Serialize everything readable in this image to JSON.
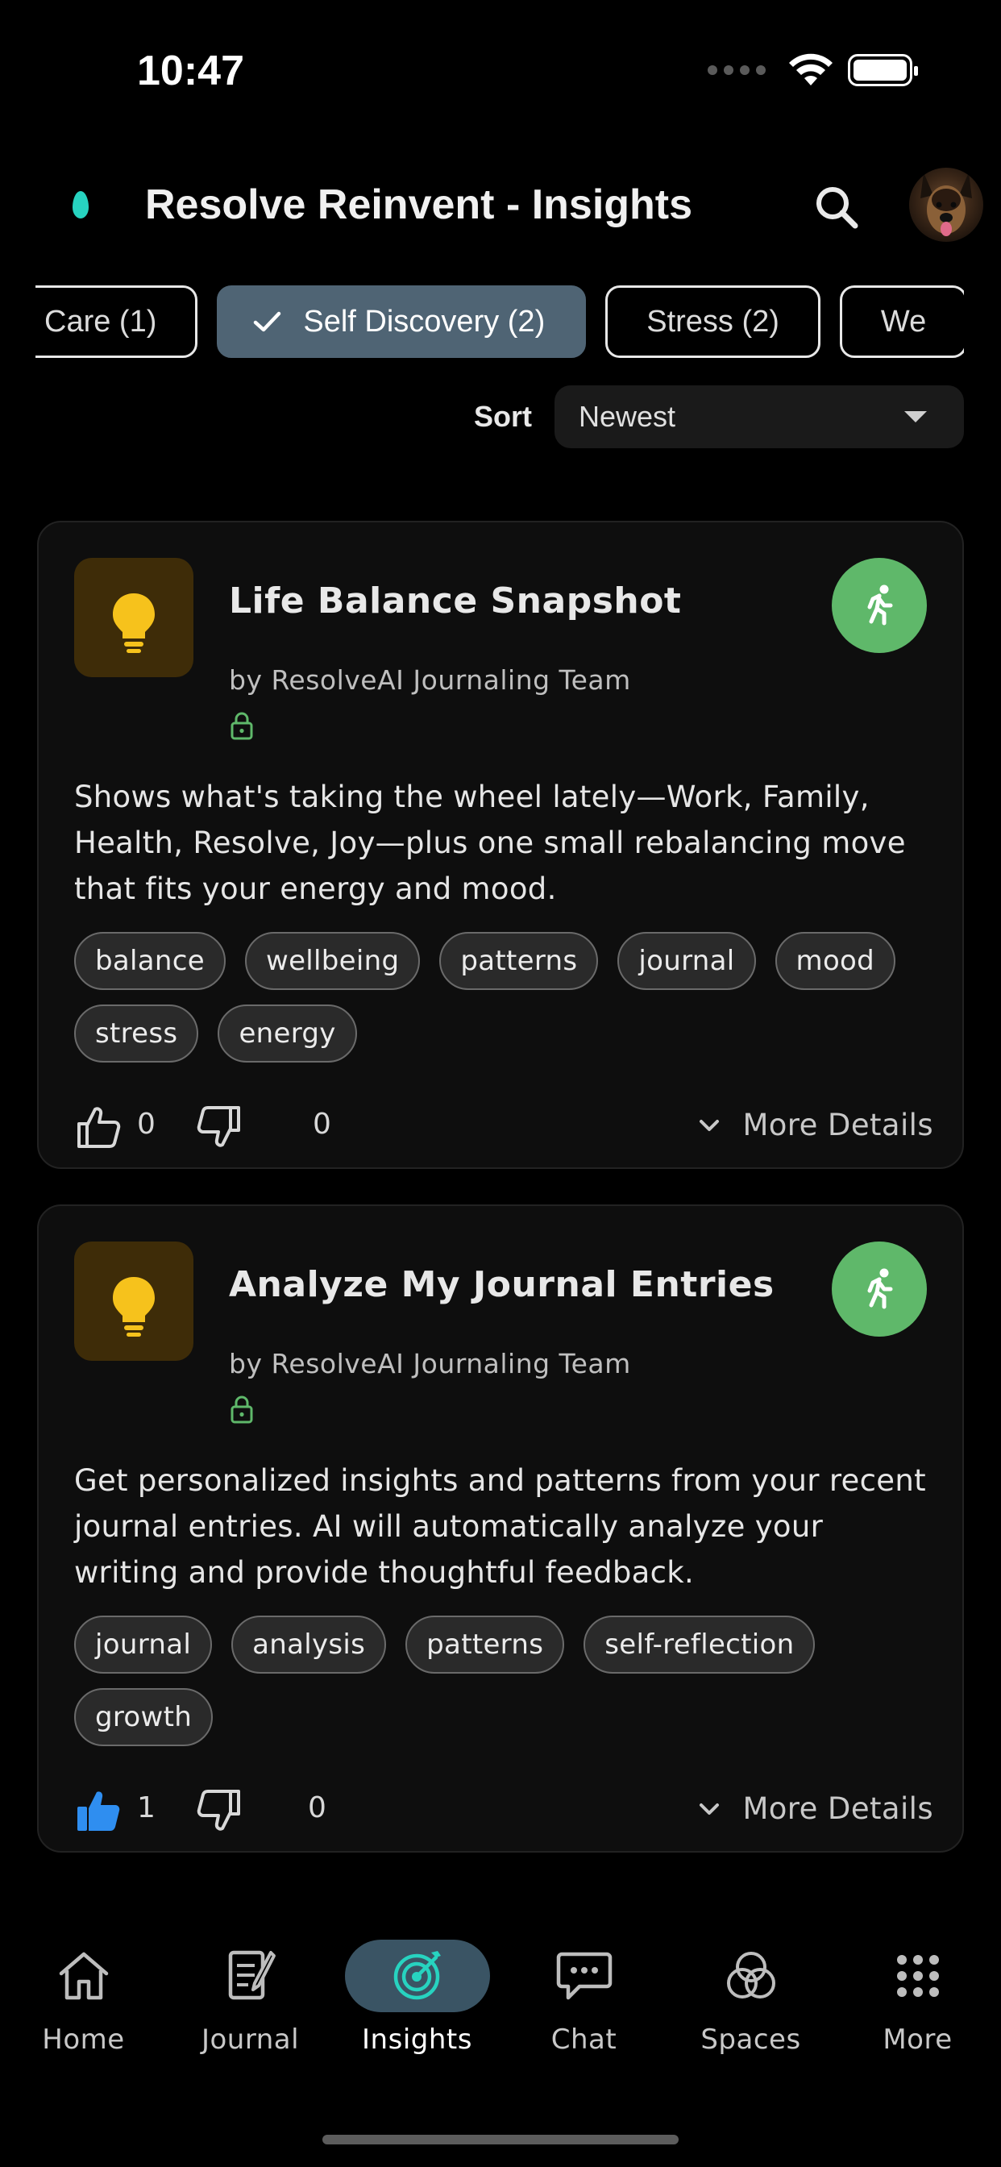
{
  "status_bar": {
    "time": "10:47"
  },
  "header": {
    "title": "Resolve Reinvent - Insights",
    "search_icon": "search-icon",
    "avatar_icon": "dog-avatar"
  },
  "filters": {
    "chips": [
      {
        "label": "Care (1)",
        "selected": false
      },
      {
        "label": "Self Discovery (2)",
        "selected": true
      },
      {
        "label": "Stress (2)",
        "selected": false
      },
      {
        "label": "We",
        "selected": false
      }
    ]
  },
  "sort": {
    "label": "Sort",
    "value": "Newest"
  },
  "cards": [
    {
      "title": "Life Balance Snapshot",
      "author": "by ResolveAI Journaling Team",
      "description": "Shows what's taking the wheel lately—Work, Family, Health, Resolve, Joy—plus one small rebalancing move that fits your energy and mood.",
      "tags": [
        "balance",
        "wellbeing",
        "patterns",
        "journal",
        "mood",
        "stress",
        "energy"
      ],
      "likes": "0",
      "dislikes": "0",
      "liked": false,
      "more_label": "More Details"
    },
    {
      "title": "Analyze My Journal Entries",
      "author": "by ResolveAI Journaling Team",
      "description": "Get personalized insights and patterns from your recent journal entries. AI will automatically analyze your writing and provide thoughtful feedback.",
      "tags": [
        "journal",
        "analysis",
        "patterns",
        "self-reflection",
        "growth"
      ],
      "likes": "1",
      "dislikes": "0",
      "liked": true,
      "more_label": "More Details"
    }
  ],
  "nav": {
    "items": [
      {
        "label": "Home",
        "icon": "home-icon",
        "active": false
      },
      {
        "label": "Journal",
        "icon": "journal-icon",
        "active": false
      },
      {
        "label": "Insights",
        "icon": "insights-icon",
        "active": true
      },
      {
        "label": "Chat",
        "icon": "chat-icon",
        "active": false
      },
      {
        "label": "Spaces",
        "icon": "spaces-icon",
        "active": false
      },
      {
        "label": "More",
        "icon": "more-icon",
        "active": false
      }
    ]
  },
  "colors": {
    "accent_teal": "#27d3c0",
    "selected_chip": "#4f6474",
    "run_button": "#5fb86a",
    "like_active": "#2f8ef0",
    "bulb": "#f6c21c",
    "lock": "#5fb86a"
  }
}
